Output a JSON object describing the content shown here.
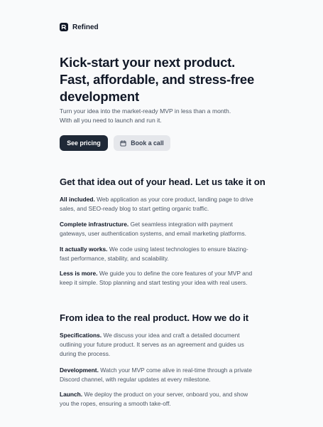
{
  "brand": {
    "name": "Refined"
  },
  "hero": {
    "title_lines": [
      "Kick-start your next product.",
      "Fast, affordable, and stress-free",
      "development"
    ],
    "subtitle_lines": [
      "Turn your idea into the market-ready MVP in less than a month.",
      "With all you need to launch and run it."
    ],
    "primary_button": "See pricing",
    "secondary_button": "Book a call",
    "secondary_button_icon": "calendar-icon"
  },
  "features": {
    "title": "Get that idea out of your head. Let us take it on",
    "items": [
      {
        "heading": "All included.",
        "lines": [
          "Web application as your core product, landing page to drive",
          "sales, and SEO-ready blog to start getting organic traffic."
        ]
      },
      {
        "heading": "Complete infrastructure.",
        "lines": [
          "Get seamless integration with payment",
          "gateways, user authentication systems, and email marketing platforms."
        ]
      },
      {
        "heading": "It actually works.",
        "lines": [
          "We code using latest technologies to ensure blazing-",
          "fast performance, stability, and scalability."
        ]
      },
      {
        "heading": "Less is more.",
        "lines": [
          "We guide you to define the core features of your MVP and",
          "keep it simple. Stop planning and start testing your idea with real users."
        ]
      }
    ]
  },
  "process": {
    "title": "From idea to the real product. How we do it",
    "items": [
      {
        "heading": "Specifications.",
        "lines": [
          "We discuss your idea and craft a detailed document",
          "outlining your future product. It serves as an agreement and guides us",
          "during the process."
        ]
      },
      {
        "heading": "Development.",
        "lines": [
          "Watch your MVP come alive in real-time through a private",
          "Discord channel, with regular updates at every milestone."
        ]
      },
      {
        "heading": "Launch.",
        "lines": [
          "We deploy the product on your server, onboard you, and show",
          "you the ropes, ensuring a smooth take-off."
        ]
      }
    ]
  }
}
